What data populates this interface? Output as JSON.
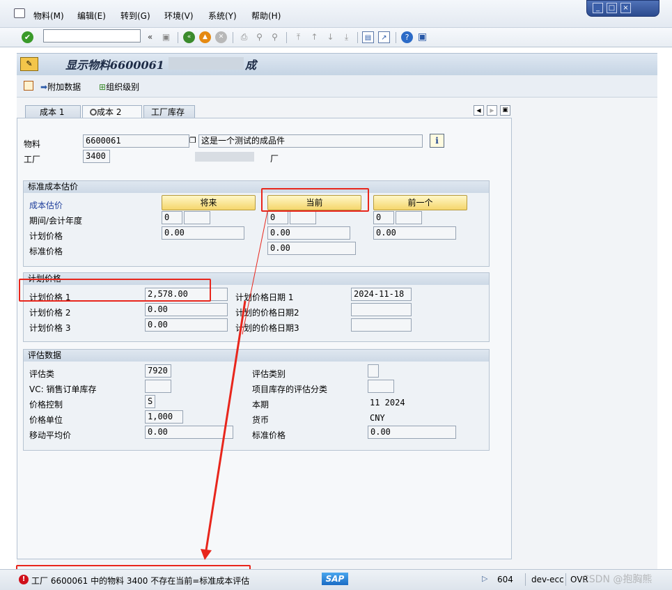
{
  "menu": [
    "物料(M)",
    "编辑(E)",
    "转到(G)",
    "环境(V)",
    "系统(Y)",
    "帮助(H)"
  ],
  "title": "显示物料6600061",
  "title_suffix": "成品)",
  "appbar": {
    "additional_data": "附加数据",
    "org_levels": "组织级别"
  },
  "tabs": [
    "成本 1",
    "成本 2",
    "工厂库存"
  ],
  "header": {
    "material_label": "物料",
    "material_value": "6600061",
    "material_desc": "这是一个测试的成品件",
    "plant_label": "工厂",
    "plant_value": "3400",
    "plant_desc": "厂"
  },
  "std_cost": {
    "title": "标准成本估价",
    "cost_estimate_label": "成本估价",
    "btn_future": "将来",
    "btn_current": "当前",
    "btn_previous": "前一个",
    "period_label": "期间/会计年度",
    "planned_price_label": "计划价格",
    "standard_price_label": "标准价格",
    "future_period": "0",
    "current_period": "0",
    "previous_period": "0",
    "future_price": "0.00",
    "current_price": "0.00",
    "previous_price": "0.00",
    "current_std_price": "0.00"
  },
  "planned": {
    "title": "计划价格",
    "price1_label": "计划价格 1",
    "price1": "2,578.00",
    "price2_label": "计划价格 2",
    "price2": "0.00",
    "price3_label": "计划价格 3",
    "price3": "0.00",
    "date1_label": "计划价格日期 1",
    "date1": "2024-11-18",
    "date2_label": "计划的价格日期2",
    "date3_label": "计划的价格日期3"
  },
  "valuation": {
    "title": "评估数据",
    "class_label": "评估类",
    "class_value": "7920",
    "vc_label": "VC: 销售订单库存",
    "price_control_label": "价格控制",
    "price_control_value": "S",
    "price_unit_label": "价格单位",
    "price_unit_value": "1,000",
    "mavg_label": "移动平均价",
    "mavg_value": "0.00",
    "val_category_label": "评估类别",
    "proj_stock_label": "项目库存的评估分类",
    "period_label": "本期",
    "period_value": "11  2024",
    "currency_label": "货币",
    "currency_value": "CNY",
    "std_price_label": "标准价格",
    "std_price_value": "0.00"
  },
  "status": {
    "message": "工厂 6600061 中的物料 3400 不存在当前=标准成本评估",
    "sap_logo": "SAP",
    "session": "604",
    "system": "dev-ecc",
    "mode": "OVR",
    "watermark": "CSDN @抱胸熊"
  },
  "colors": {
    "highlight": "#e8261c",
    "button": "#f5d66c",
    "error": "#d0101a"
  }
}
